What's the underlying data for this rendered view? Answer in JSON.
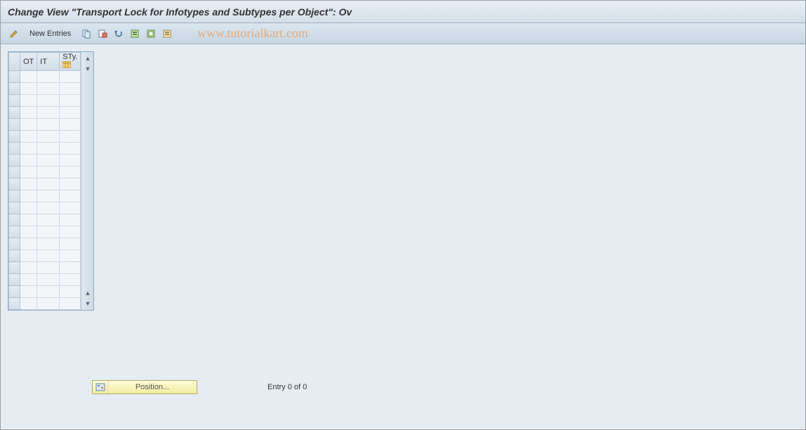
{
  "title": "Change View \"Transport Lock for Infotypes and Subtypes per Object\": Ov",
  "toolbar": {
    "new_entries_label": "New Entries"
  },
  "watermark": "www.tutorialkart.com",
  "grid": {
    "columns": {
      "ot": "OT",
      "it": "IT",
      "sty": "STy."
    },
    "row_count": 20
  },
  "footer": {
    "position_label": "Position...",
    "entry_text": "Entry 0 of 0"
  }
}
